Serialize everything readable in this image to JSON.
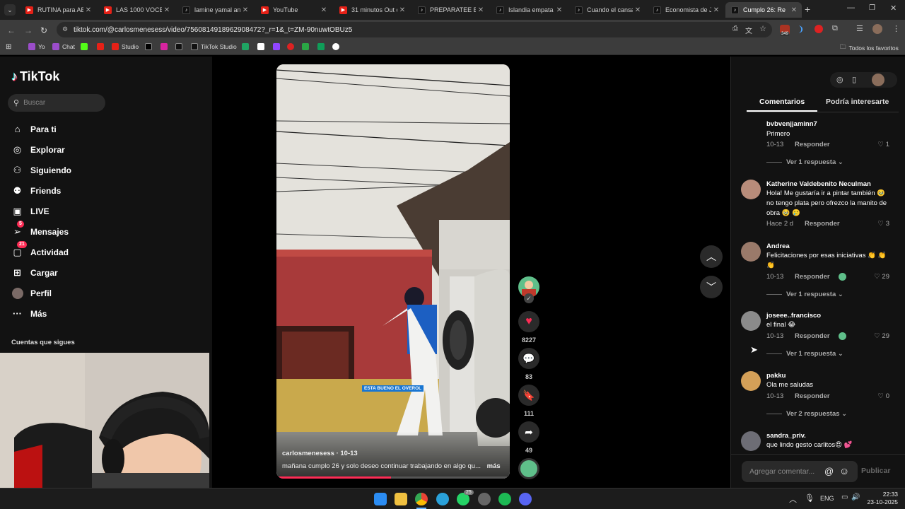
{
  "browser": {
    "tabs": [
      {
        "title": "RUTINA para ABD",
        "icon": "youtube-icon"
      },
      {
        "title": "LAS 1000 VOCES",
        "icon": "youtube-icon"
      },
      {
        "title": "lamine yamal ant",
        "icon": "tiktok-icon"
      },
      {
        "title": "YouTube",
        "icon": "youtube-icon"
      },
      {
        "title": "31 minutos Out o",
        "icon": "youtube-icon"
      },
      {
        "title": "PREPARATEE BAY",
        "icon": "tiktok-icon"
      },
      {
        "title": "Islandia empata 2",
        "icon": "tiktok-icon"
      },
      {
        "title": "Cuando el cansan",
        "icon": "tiktok-icon"
      },
      {
        "title": "Economista de Ja",
        "icon": "tiktok-icon"
      },
      {
        "title": "Cumplo 26: Re",
        "icon": "tiktok-icon",
        "active": true
      }
    ],
    "url": "tiktok.com/@carlosmenesess/video/7560814918962908472?_r=1&_t=ZM-90nuwtOBUz5",
    "bookmarks": [
      "Yo",
      "Chat",
      "Studio",
      "TikTok Studio"
    ],
    "all_bookmarks": "Todos los favoritos",
    "ext_badge": "349"
  },
  "tiktok": {
    "logo": "TikTok",
    "search_placeholder": "Buscar",
    "menu": [
      {
        "label": "Para ti",
        "icon": "home-icon"
      },
      {
        "label": "Explorar",
        "icon": "compass-icon"
      },
      {
        "label": "Siguiendo",
        "icon": "following-icon"
      },
      {
        "label": "Friends",
        "icon": "friends-icon"
      },
      {
        "label": "LIVE",
        "icon": "live-icon"
      },
      {
        "label": "Mensajes",
        "icon": "messages-icon",
        "badge": "5"
      },
      {
        "label": "Actividad",
        "icon": "activity-icon",
        "badge": "21"
      },
      {
        "label": "Cargar",
        "icon": "upload-icon"
      },
      {
        "label": "Perfil",
        "icon": "profile-icon"
      },
      {
        "label": "Más",
        "icon": "more-icon"
      }
    ],
    "following_heading": "Cuentas que sigues"
  },
  "video": {
    "author": "carlosmenesess · 10-13",
    "caption": "mañana cumplo 26 y solo deseo continuar trabajando en algo qu...",
    "more": "más",
    "overlay_text": "ESTA BUENO EL OVEROL",
    "likes": "8227",
    "comments": "83",
    "saves": "111",
    "shares": "49"
  },
  "panel": {
    "tabs": [
      "Comentarios",
      "Podría interesarte"
    ],
    "add_comment_placeholder": "Agregar comentar...",
    "publish": "Publicar",
    "reply_label": "Responder",
    "comments": [
      {
        "user": "bvbvenjjaminn7",
        "text": "Primero",
        "date": "10-13",
        "likes": "1",
        "more": "Ver 1 respuesta"
      },
      {
        "user": "Katherine Valdebenito Neculman",
        "text": "Hola! Me gustaría ir a pintar también 🥹 no tengo plata pero ofrezco la manito de obra 🥹 🥲",
        "date": "Hace 2 d",
        "likes": "3",
        "more": ""
      },
      {
        "user": "Andrea",
        "text": "Felicitaciones por esas iniciativas 👏 👏 👏",
        "date": "10-13",
        "likes": "29",
        "more": "Ver 1 respuesta"
      },
      {
        "user": "joseee..francisco",
        "text": "el final 😂",
        "date": "10-13",
        "likes": "29",
        "more": "Ver 1 respuesta"
      },
      {
        "user": "pakku",
        "text": "Ola me saludas",
        "date": "10-13",
        "likes": "0",
        "more": "Ver 2 respuestas"
      },
      {
        "user": "sandra_priv.",
        "text": "que lindo gesto carlitos😍 💕",
        "date": "",
        "likes": "",
        "more": ""
      }
    ]
  },
  "taskbar": {
    "lang": "ENG",
    "time": "22:33",
    "date": "23-10-2025",
    "whatsapp_badge": "25"
  }
}
